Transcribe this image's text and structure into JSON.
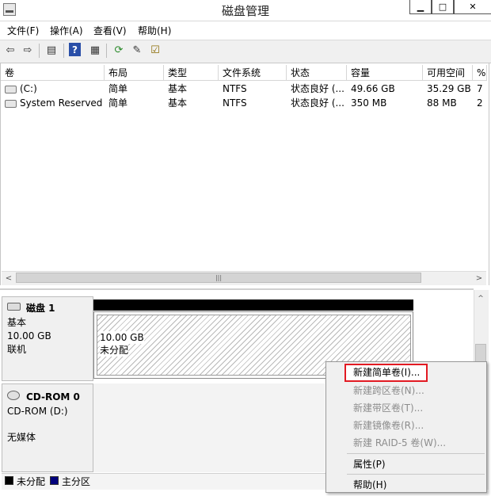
{
  "window": {
    "title": "磁盘管理",
    "min_glyph": "▁",
    "max_glyph": "□",
    "close_glyph": "✕"
  },
  "menubar": [
    {
      "label": "文件(F)"
    },
    {
      "label": "操作(A)"
    },
    {
      "label": "查看(V)"
    },
    {
      "label": "帮助(H)"
    }
  ],
  "toolbar": {
    "back_glyph": "⇦",
    "forward_glyph": "⇨",
    "view_glyph": "▤",
    "help_glyph": "?",
    "props_glyph": "▦",
    "refresh_glyph": "⟳",
    "rescan_glyph": "✎",
    "settings_glyph": "☑"
  },
  "volume_table": {
    "columns": [
      "卷",
      "布局",
      "类型",
      "文件系统",
      "状态",
      "容量",
      "可用空间",
      "%"
    ],
    "rows": [
      {
        "volume": "(C:)",
        "layout": "简单",
        "type": "基本",
        "fs": "NTFS",
        "status": "状态良好 (...",
        "capacity": "49.66 GB",
        "free": "35.29 GB",
        "pct": "7"
      },
      {
        "volume": "System Reserved",
        "layout": "简单",
        "type": "基本",
        "fs": "NTFS",
        "status": "状态良好 (...",
        "capacity": "350 MB",
        "free": "88 MB",
        "pct": "2"
      }
    ]
  },
  "scroll": {
    "left_glyph": "<",
    "right_glyph": ">",
    "grip_glyph": "|||",
    "up_glyph": "^"
  },
  "disks": {
    "disk1": {
      "name": "磁盘 1",
      "type": "基本",
      "size": "10.00 GB",
      "state": "联机",
      "partition_size": "10.00 GB",
      "partition_state": "未分配"
    },
    "cdrom": {
      "name": "CD-ROM 0",
      "type": "CD-ROM (D:)",
      "media": "无媒体"
    }
  },
  "legend": [
    {
      "label": "未分配",
      "color": "#000000"
    },
    {
      "label": "主分区",
      "color": "#00007b"
    }
  ],
  "context_menu": {
    "new_simple": "新建简单卷(I)...",
    "new_spanned": "新建跨区卷(N)...",
    "new_striped": "新建带区卷(T)...",
    "new_mirrored": "新建镜像卷(R)...",
    "new_raid5": "新建 RAID-5 卷(W)...",
    "properties": "属性(P)",
    "help": "帮助(H)"
  },
  "colors": {
    "highlight_border": "#e21a23",
    "disk_header": "#000000"
  }
}
